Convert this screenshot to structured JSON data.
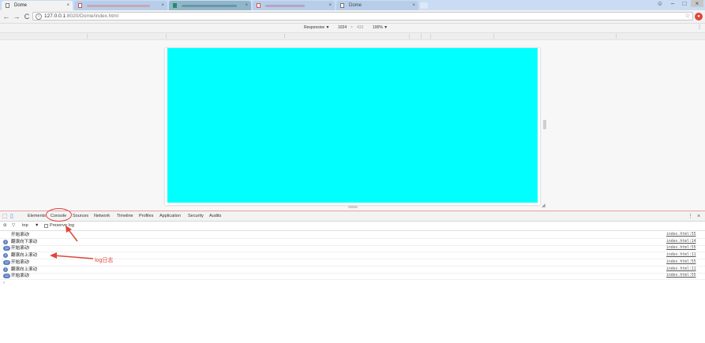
{
  "browser": {
    "tabs": [
      {
        "label": "Dome",
        "active": true
      },
      {
        "label": "",
        "active": false
      },
      {
        "label": "",
        "active": false
      },
      {
        "label": "",
        "active": false
      },
      {
        "label": "Dome",
        "active": false
      }
    ],
    "url_host": "127.0.0.1",
    "url_path": ":8020/Dome/index.html"
  },
  "device_toolbar": {
    "mode": "Responsive ▼",
    "width": "1024",
    "times": "×",
    "height": "433",
    "zoom": "100% ▼"
  },
  "page": {
    "box_color": "#00ffff"
  },
  "devtools": {
    "tabs": [
      "Elements",
      "Console",
      "Sources",
      "Network",
      "Timeline",
      "Profiles",
      "Application",
      "Security",
      "Audits"
    ],
    "active_tab": "Console",
    "context": "top",
    "preserve_log": "Preserve log",
    "logs": [
      {
        "badge": "",
        "text": "开始滚动!",
        "source": "index.html:55"
      },
      {
        "badge": "2",
        "text": "翻滚向下滚动",
        "source": "index.html:14"
      },
      {
        "badge": "12",
        "text": "开始滚动!",
        "source": "index.html:55"
      },
      {
        "badge": "2",
        "text": "翻滚向上滚动",
        "source": "index.html:11"
      },
      {
        "badge": "12",
        "text": "开始滚动!",
        "source": "index.html:55"
      },
      {
        "badge": "2",
        "text": "翻滚向上滚动",
        "source": "index.html:11"
      },
      {
        "badge": "12",
        "text": "开始滚动!",
        "source": "index.html:55"
      }
    ],
    "prompt": "›"
  },
  "annotation": {
    "label": "log日志",
    "color": "#e0463b"
  }
}
